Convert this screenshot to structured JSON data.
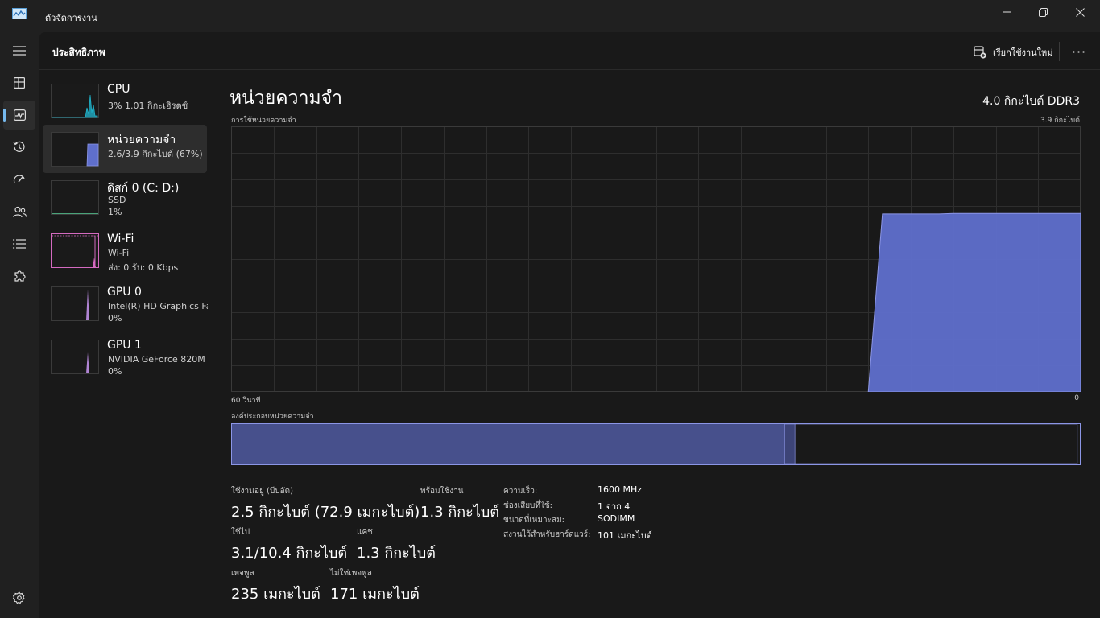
{
  "window": {
    "title": "ตัวจัดการงาน"
  },
  "header": {
    "page_title": "ประสิทธิภาพ",
    "run_task_label": "เรียกใช้งานใหม่",
    "more_label": "···"
  },
  "devices": [
    {
      "name": "CPU",
      "line2": "3%  1.01 กิกะเฮิรตซ์",
      "line3": "",
      "selected": false
    },
    {
      "name": "หน่วยความจำ",
      "line2": "2.6/3.9 กิกะไบต์ (67%)",
      "line3": "",
      "selected": true
    },
    {
      "name": "ดิสก์ 0 (C: D:)",
      "line2": "SSD",
      "line3": "1%",
      "selected": false
    },
    {
      "name": "Wi-Fi",
      "line2": "Wi-Fi",
      "line3": "ส่ง: 0 รับ: 0 Kbps",
      "selected": false
    },
    {
      "name": "GPU 0",
      "line2": "Intel(R) HD Graphics Family",
      "line3": "0%",
      "selected": false
    },
    {
      "name": "GPU 1",
      "line2": "NVIDIA GeForce 820M",
      "line3": "0%",
      "selected": false
    }
  ],
  "detail": {
    "title": "หน่วยความจำ",
    "capacity": "4.0 กิกะไบต์ DDR3",
    "graph_label": "การใช้หน่วยความจำ",
    "graph_max": "3.9 กิกะไบต์",
    "time_left": "60 วินาที",
    "time_right": "0",
    "composition_label": "องค์ประกอบหน่วยความจำ"
  },
  "stats": {
    "in_use_label": "ใช้งานอยู่ (บีบอัด)",
    "in_use_value": "2.5 กิกะไบต์ (72.9 เมกะไบต์)",
    "available_label": "พร้อมใช้งาน",
    "available_value": "1.3 กิกะไบต์",
    "committed_label": "ใช้ไป",
    "committed_value": "3.1/10.4 กิกะไบต์",
    "cached_label": "แคช",
    "cached_value": "1.3 กิกะไบต์",
    "paged_label": "เพจพูล",
    "paged_value": "235 เมกะไบต์",
    "nonpaged_label": "ไม่ใช่เพจพูล",
    "nonpaged_value": "171 เมกะไบต์"
  },
  "info": {
    "speed_label": "ความเร็ว:",
    "speed_value": "1600 MHz",
    "slots_label": "ช่องเสียบที่ใช้:",
    "slots_value": "1 จาก 4",
    "form_label": "ขนาดที่เหมาะสม:",
    "form_value": "SODIMM",
    "reserved_label": "สงวนไว้สำหรับฮาร์ดแวร์:",
    "reserved_value": "101 เมกะไบต์"
  },
  "memory_usage_series": [
    0,
    0,
    0,
    0,
    0,
    0,
    0,
    0,
    0,
    0,
    0,
    0,
    0,
    0,
    0,
    0,
    0,
    0,
    0,
    0,
    0,
    0,
    0,
    0,
    0,
    0,
    0,
    0,
    0,
    0,
    0,
    0,
    0,
    0,
    0,
    0,
    0,
    0,
    0,
    0,
    0,
    0,
    0,
    0,
    0,
    0,
    0.67,
    0.67,
    0.67,
    0.67,
    0.67,
    0.672,
    0.672,
    0.672,
    0.672,
    0.672,
    0.672,
    0.672,
    0.672,
    0.672,
    0.672
  ],
  "composition_fractions": {
    "in_use": 0.652,
    "modified": 0.012,
    "standby": 0.333,
    "free": 0.003
  },
  "colors": {
    "accent": "#76b9ed",
    "memory_fill": "#5f6fcc",
    "memory_line": "#8c96e6",
    "cpu": "#1fb3c9",
    "wifi": "#d46ac0",
    "gpu": "#b084d4"
  }
}
